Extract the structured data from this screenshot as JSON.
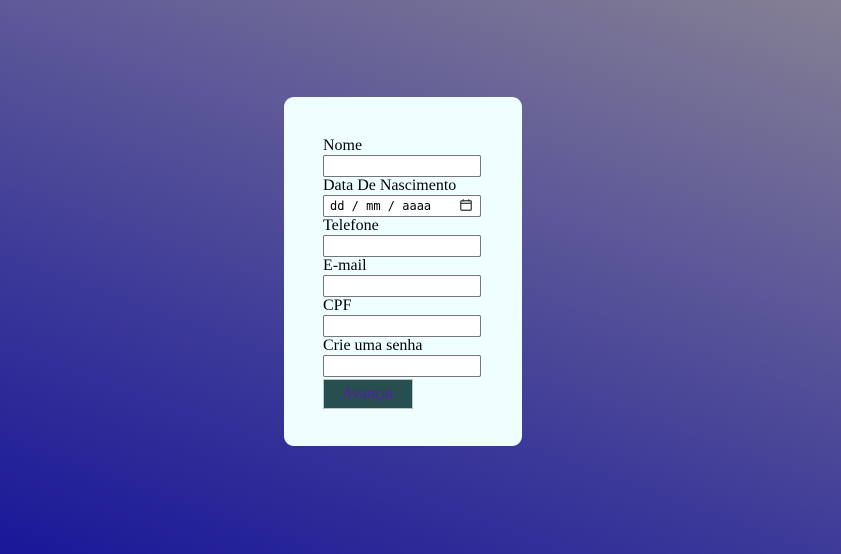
{
  "form": {
    "fields": [
      {
        "label": "Nome",
        "value": ""
      },
      {
        "label": "Data De Nascimento",
        "placeholder": "dd / mm / aaaa"
      },
      {
        "label": "Telefone",
        "value": ""
      },
      {
        "label": "E-mail",
        "value": ""
      },
      {
        "label": "CPF",
        "value": ""
      },
      {
        "label": "Crie uma senha",
        "value": ""
      }
    ],
    "submit_label": "Avançar"
  },
  "colors": {
    "card_background": "#efffff",
    "button_background": "#274f4f",
    "button_text": "#5a1ab0",
    "page_gradient_start": "#1a1799",
    "page_gradient_end": "#858093"
  },
  "icons": {
    "date_picker": "calendar-icon"
  }
}
